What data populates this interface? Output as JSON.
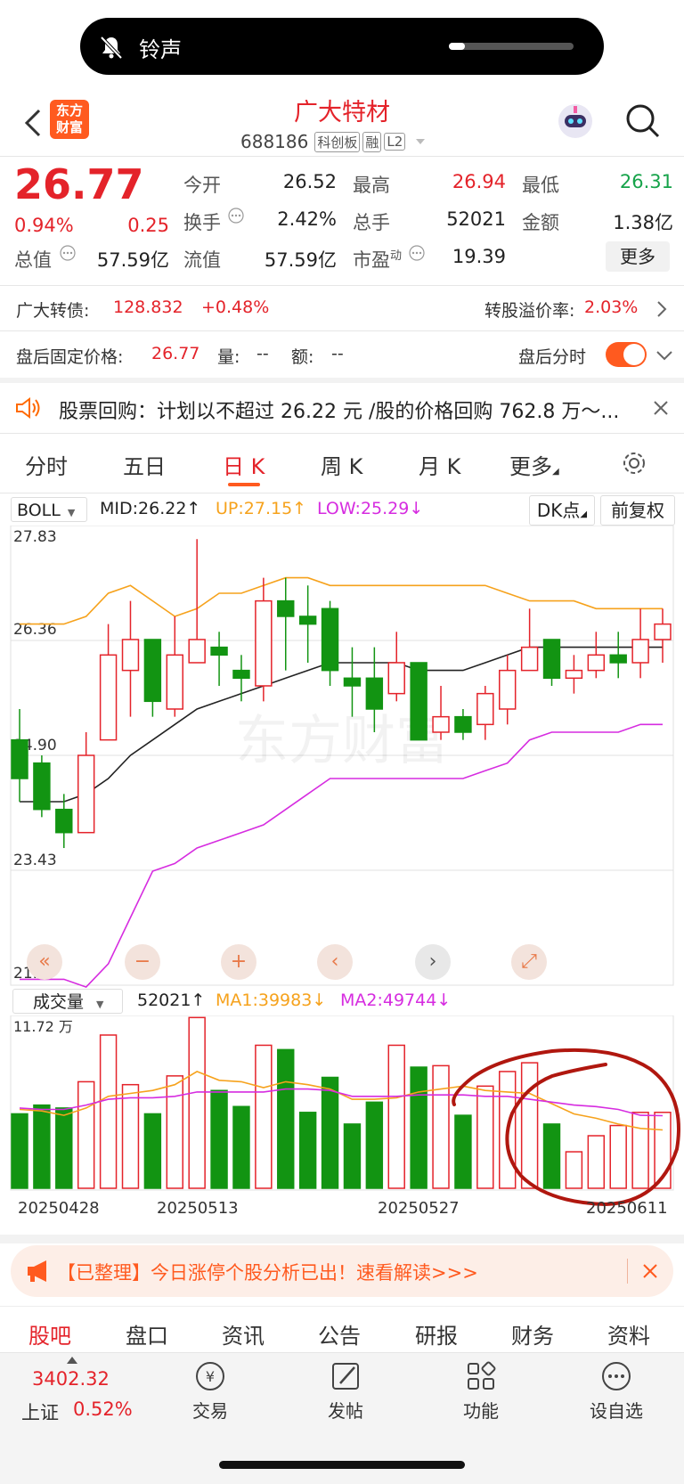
{
  "notification": {
    "label": "铃声"
  },
  "header": {
    "brand_line1": "东方",
    "brand_line2": "财富",
    "stock_name": "广大特材",
    "stock_code": "688186",
    "tags": [
      "科创板",
      "融",
      "L2"
    ]
  },
  "quote": {
    "price": "26.77",
    "change_pct": "0.94%",
    "change_amt": "0.25",
    "open_label": "今开",
    "open": "26.52",
    "high_label": "最高",
    "high": "26.94",
    "low_label": "最低",
    "low": "26.31",
    "turnover_label": "换手",
    "turnover": "2.42%",
    "volume_label": "总手",
    "volume": "52021",
    "amount_label": "金额",
    "amount": "1.38亿",
    "mktcap_label": "总值",
    "mktcap": "57.59亿",
    "float_label": "流值",
    "float": "57.59亿",
    "pe_label": "市盈",
    "pe_sup": "动",
    "pe": "19.39",
    "more_label": "更多"
  },
  "convertible": {
    "label": "广大转债:",
    "price": "128.832",
    "change": "+0.48%",
    "premium_label": "转股溢价率:",
    "premium": "2.03%"
  },
  "afterhours": {
    "label": "盘后固定价格:",
    "price": "26.77",
    "vol_label": "量:",
    "vol": "--",
    "amt_label": "额:",
    "amt": "--",
    "toggle_label": "盘后分时",
    "toggle_on": true
  },
  "announcement": {
    "text": "股票回购：计划以不超过 26.22 元 /股的价格回购 762.8 万～..."
  },
  "chart_tabs": [
    {
      "label": "分时",
      "active": false
    },
    {
      "label": "五日",
      "active": false
    },
    {
      "label": "日 K",
      "active": true
    },
    {
      "label": "周 K",
      "active": false
    },
    {
      "label": "月 K",
      "active": false
    },
    {
      "label": "更多",
      "active": false
    }
  ],
  "indicator": {
    "name": "BOLL",
    "mid": "MID:26.22",
    "up": "UP:27.15",
    "low": "LOW:25.29",
    "dk_label": "DK点",
    "adjust_label": "前复权"
  },
  "price_axis": [
    "27.83",
    "26.36",
    "24.90",
    "23.43",
    "21.97"
  ],
  "watermark": "东方财富",
  "volume_panel": {
    "name": "成交量",
    "value": "52021",
    "ma1": "MA1:39983",
    "ma2": "MA2:49744",
    "ymax_label": "11.72 万"
  },
  "dates": [
    "20250428",
    "20250513",
    "20250527",
    "20250611"
  ],
  "chart_data": {
    "type": "candlestick",
    "ylim": [
      21.97,
      27.83
    ],
    "candles": [
      {
        "o": 25.1,
        "c": 24.6,
        "h": 25.5,
        "l": 24.3
      },
      {
        "o": 24.8,
        "c": 24.2,
        "h": 24.9,
        "l": 24.1
      },
      {
        "o": 24.2,
        "c": 23.9,
        "h": 24.4,
        "l": 23.7
      },
      {
        "o": 23.9,
        "c": 24.9,
        "h": 25.2,
        "l": 23.9
      },
      {
        "o": 25.1,
        "c": 26.2,
        "h": 26.6,
        "l": 25.1
      },
      {
        "o": 26.0,
        "c": 26.4,
        "h": 26.9,
        "l": 25.4
      },
      {
        "o": 26.4,
        "c": 25.6,
        "h": 26.4,
        "l": 25.4
      },
      {
        "o": 25.5,
        "c": 26.2,
        "h": 26.7,
        "l": 25.4
      },
      {
        "o": 26.1,
        "c": 26.4,
        "h": 27.7,
        "l": 26.1
      },
      {
        "o": 26.3,
        "c": 26.2,
        "h": 26.5,
        "l": 25.8
      },
      {
        "o": 26.0,
        "c": 25.9,
        "h": 26.2,
        "l": 25.6
      },
      {
        "o": 25.8,
        "c": 26.9,
        "h": 27.2,
        "l": 25.6
      },
      {
        "o": 26.9,
        "c": 26.7,
        "h": 27.2,
        "l": 26.0
      },
      {
        "o": 26.7,
        "c": 26.6,
        "h": 27.1,
        "l": 26.1
      },
      {
        "o": 26.8,
        "c": 26.0,
        "h": 26.9,
        "l": 25.8
      },
      {
        "o": 25.9,
        "c": 25.8,
        "h": 26.3,
        "l": 25.4
      },
      {
        "o": 25.9,
        "c": 25.5,
        "h": 26.3,
        "l": 25.2
      },
      {
        "o": 25.7,
        "c": 26.1,
        "h": 26.5,
        "l": 25.6
      },
      {
        "o": 26.1,
        "c": 25.1,
        "h": 26.1,
        "l": 25.1
      },
      {
        "o": 25.2,
        "c": 25.4,
        "h": 25.8,
        "l": 25.1
      },
      {
        "o": 25.4,
        "c": 25.2,
        "h": 25.5,
        "l": 25.1
      },
      {
        "o": 25.3,
        "c": 25.7,
        "h": 25.8,
        "l": 25.1
      },
      {
        "o": 25.5,
        "c": 26.0,
        "h": 26.2,
        "l": 25.3
      },
      {
        "o": 26.0,
        "c": 26.3,
        "h": 26.8,
        "l": 26.0
      },
      {
        "o": 26.4,
        "c": 25.9,
        "h": 26.4,
        "l": 25.8
      },
      {
        "o": 25.9,
        "c": 26.0,
        "h": 26.2,
        "l": 25.7
      },
      {
        "o": 26.0,
        "c": 26.2,
        "h": 26.5,
        "l": 25.9
      },
      {
        "o": 26.2,
        "c": 26.1,
        "h": 26.5,
        "l": 25.9
      },
      {
        "o": 26.1,
        "c": 26.4,
        "h": 26.8,
        "l": 25.9
      },
      {
        "o": 26.4,
        "c": 26.6,
        "h": 26.8,
        "l": 26.1
      }
    ],
    "mid_line": [
      24.3,
      24.3,
      24.3,
      24.4,
      24.6,
      24.9,
      25.1,
      25.3,
      25.5,
      25.6,
      25.7,
      25.8,
      25.9,
      26.0,
      26.1,
      26.1,
      26.1,
      26.1,
      26.0,
      26.0,
      26.0,
      26.1,
      26.2,
      26.3,
      26.3,
      26.3,
      26.3,
      26.3,
      26.3,
      26.3
    ],
    "up_line": [
      26.6,
      26.6,
      26.6,
      26.7,
      27.0,
      27.1,
      26.9,
      26.7,
      26.8,
      27.0,
      27.0,
      27.1,
      27.2,
      27.2,
      27.1,
      27.1,
      27.1,
      27.1,
      27.1,
      27.1,
      27.1,
      27.1,
      27.0,
      26.9,
      26.9,
      26.9,
      26.8,
      26.8,
      26.8,
      26.8
    ],
    "low_line": [
      22.0,
      22.0,
      22.0,
      21.9,
      22.2,
      22.8,
      23.4,
      23.5,
      23.7,
      23.8,
      23.9,
      24.0,
      24.2,
      24.4,
      24.6,
      24.6,
      24.6,
      24.6,
      24.6,
      24.6,
      24.6,
      24.7,
      24.8,
      25.1,
      25.2,
      25.2,
      25.2,
      25.2,
      25.3,
      25.3
    ],
    "volume_ylim": [
      0,
      117200
    ],
    "volumes": [
      51000,
      57000,
      55000,
      73000,
      105000,
      71000,
      51000,
      77000,
      117000,
      67000,
      56000,
      98000,
      95000,
      52000,
      76000,
      44000,
      59000,
      98000,
      83000,
      84000,
      50000,
      70000,
      80000,
      86000,
      44000,
      25000,
      36000,
      43000,
      52000,
      52021
    ],
    "volume_up": [
      false,
      false,
      false,
      true,
      true,
      true,
      false,
      true,
      true,
      false,
      false,
      true,
      false,
      false,
      false,
      false,
      false,
      true,
      false,
      true,
      false,
      true,
      true,
      true,
      false,
      true,
      true,
      true,
      true,
      true
    ],
    "ma1": [
      54000,
      53000,
      50000,
      55000,
      63000,
      65000,
      67000,
      71000,
      80000,
      74000,
      73000,
      69000,
      73000,
      71000,
      68000,
      61000,
      61000,
      62000,
      66000,
      68000,
      70000,
      67000,
      66000,
      65000,
      58000,
      51000,
      48000,
      44000,
      41000,
      39983
    ],
    "ma2": [
      55000,
      54000,
      54000,
      57000,
      61000,
      62000,
      62000,
      63000,
      66000,
      66000,
      66000,
      66000,
      68000,
      68000,
      67000,
      63000,
      63000,
      63000,
      64000,
      64000,
      64000,
      63000,
      63000,
      61000,
      59000,
      57000,
      56000,
      54000,
      50000,
      49744
    ]
  },
  "bottom_banner": {
    "text": "【已整理】今日涨停个股分析已出！速看解读>>>"
  },
  "nav_tabs": [
    {
      "label": "股吧",
      "active": true
    },
    {
      "label": "盘口",
      "active": false
    },
    {
      "label": "资讯",
      "active": false
    },
    {
      "label": "公告",
      "active": false
    },
    {
      "label": "研报",
      "active": false
    },
    {
      "label": "财务",
      "active": false
    },
    {
      "label": "资料",
      "active": false
    }
  ],
  "dock": {
    "index_value": "3402.32",
    "index_name": "上证",
    "index_change": "0.52%",
    "items": [
      {
        "label": "交易",
        "icon": "yen-icon"
      },
      {
        "label": "发帖",
        "icon": "edit-icon"
      },
      {
        "label": "功能",
        "icon": "grid-icon"
      },
      {
        "label": "设自选",
        "icon": "more-icon"
      }
    ]
  },
  "colors": {
    "up": "#e4232a",
    "down": "#129412",
    "mid": "#222222",
    "upper": "#f6a21c",
    "lower": "#d62ce0",
    "accent": "#ff6a00"
  }
}
